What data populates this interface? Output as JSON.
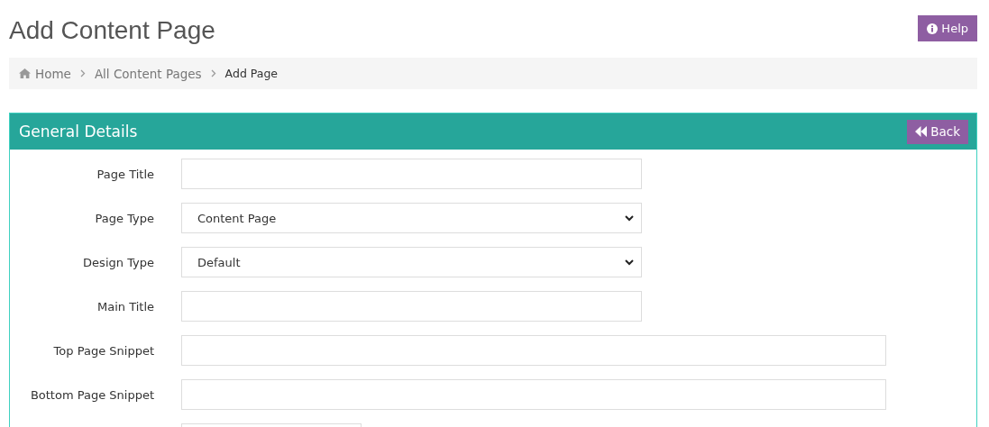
{
  "page_title": "Add Content Page",
  "help_button": "Help",
  "breadcrumb": [
    {
      "label": "Home",
      "kind": "home"
    },
    {
      "label": "All Content Pages",
      "kind": "link"
    },
    {
      "label": "Add Page",
      "kind": "current"
    }
  ],
  "panel": {
    "title": "General Details",
    "back_button": "Back",
    "fields": [
      {
        "label": "Page Title",
        "kind": "text"
      },
      {
        "label": "Page Type",
        "kind": "select",
        "value": "Content Page"
      },
      {
        "label": "Design Type",
        "kind": "select",
        "value": "Default"
      },
      {
        "label": "Main Title",
        "kind": "text"
      },
      {
        "label": "Top Page Snippet",
        "kind": "long_text"
      },
      {
        "label": "Bottom Page Snippet",
        "kind": "long_text"
      },
      {
        "kind": "short_text"
      }
    ]
  }
}
